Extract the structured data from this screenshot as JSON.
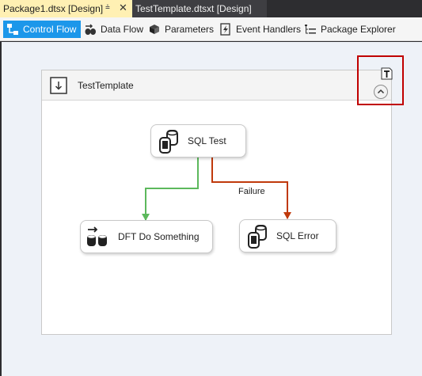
{
  "doc_tabs": [
    {
      "label": "Package1.dtsx [Design]",
      "active": true
    },
    {
      "label": "TestTemplate.dtsxt [Design]",
      "active": false
    }
  ],
  "designer_tabs": [
    {
      "label": "Control Flow",
      "icon": "control-flow-icon",
      "active": true
    },
    {
      "label": "Data Flow",
      "icon": "data-flow-icon",
      "active": false
    },
    {
      "label": "Parameters",
      "icon": "parameters-icon",
      "active": false
    },
    {
      "label": "Event Handlers",
      "icon": "event-handlers-icon",
      "active": false
    },
    {
      "label": "Package Explorer",
      "icon": "package-explorer-icon",
      "active": false
    }
  ],
  "container": {
    "title": "TestTemplate",
    "icon": "template-container-icon",
    "collapse_icon": "collapse-chevron-up-icon",
    "annotation_icon": "text-annotation-icon"
  },
  "tasks": {
    "sql_test": "SQL Test",
    "dft": "DFT Do Something",
    "sql_error": "SQL Error"
  },
  "connectors": {
    "failure_label": "Failure",
    "success_color": "#5cb85c",
    "failure_color": "#c0390b"
  },
  "colors": {
    "accent": "#1c97ea",
    "active_doc_tab": "#fff0b3",
    "highlight": "#c00000"
  }
}
